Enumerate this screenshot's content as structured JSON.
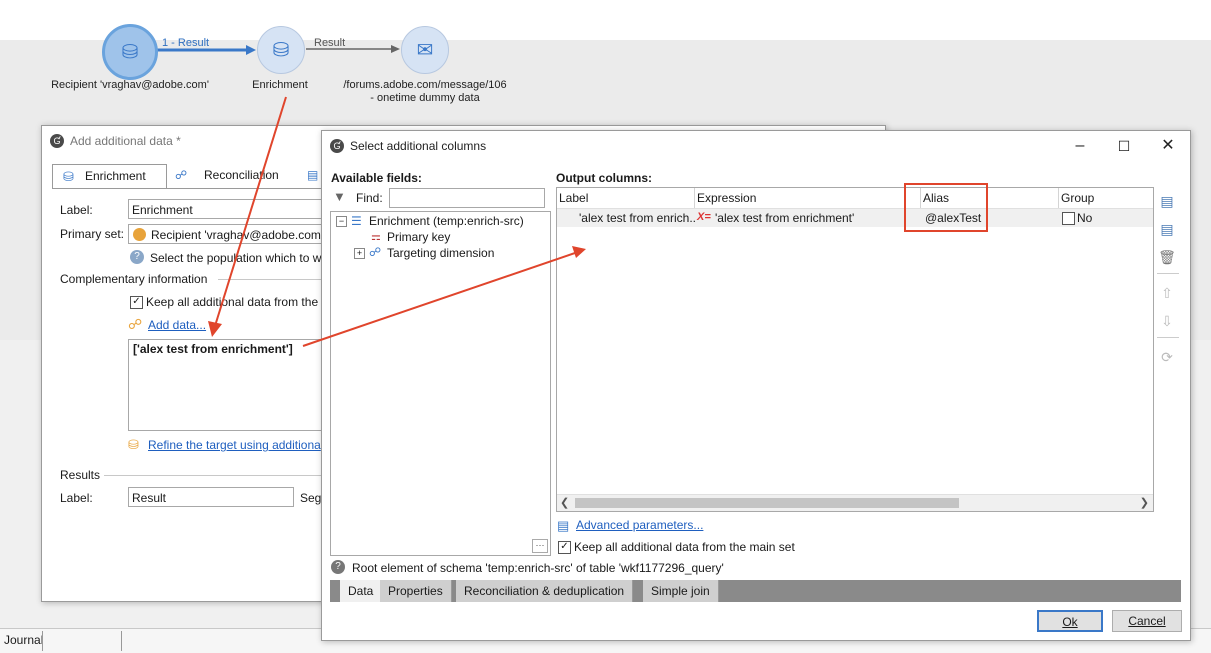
{
  "workflow": {
    "edge1_label": "1 - Result",
    "edge2_label": "Result",
    "node1_label": "Recipient 'vraghav@adobe.com'",
    "node2_label": "Enrichment",
    "node3_label_line1": "/forums.adobe.com/message/106",
    "node3_label_line2": "- onetime dummy data"
  },
  "add_dialog": {
    "title": "Add additional data *",
    "tabs": [
      "Enrichment",
      "Reconciliation"
    ],
    "label_caption": "Label:",
    "label_value": "Enrichment",
    "primary_set_caption": "Primary set:",
    "primary_set_value": "Recipient 'vraghav@adobe.com'",
    "help_text": "Select the population which to w",
    "complementary_caption": "Complementary information",
    "keep_all_text": "Keep all additional data from the",
    "add_data_link": "Add data...",
    "data_box_text": "['alex test from enrichment']",
    "refine_link": "Refine the target using additiona",
    "results_caption": "Results",
    "result_label_caption": "Label:",
    "result_label_value": "Result",
    "segment_caption": "Segr"
  },
  "select_dialog": {
    "title": "Select additional columns",
    "available_fields_caption": "Available fields:",
    "find_caption": "Find:",
    "find_value": "",
    "tree": {
      "root": "Enrichment (temp:enrich-src)",
      "child1": "Primary key",
      "child2": "Targeting dimension"
    },
    "output_columns_caption": "Output columns:",
    "grid_headers": [
      "Label",
      "Expression",
      "Alias",
      "Group"
    ],
    "grid_row": {
      "label": "'alex test from enrich...",
      "expression": "'alex test from enrichment'",
      "alias": "@alexTest",
      "group": "No"
    },
    "advanced_link": "Advanced parameters...",
    "keep_all_text": "Keep all additional data from the main set",
    "status_text": "Root element of schema 'temp:enrich-src' of table 'wkf1177296_query'",
    "bottom_tabs": [
      "Data",
      "Properties",
      "Reconciliation & deduplication",
      "Simple join"
    ],
    "ok_label": "Ok",
    "cancel_label": "Cancel"
  },
  "taskbar": {
    "journal_label": "Journal"
  },
  "colors": {
    "accent": "#3a78c8",
    "highlight": "#e0452c"
  }
}
